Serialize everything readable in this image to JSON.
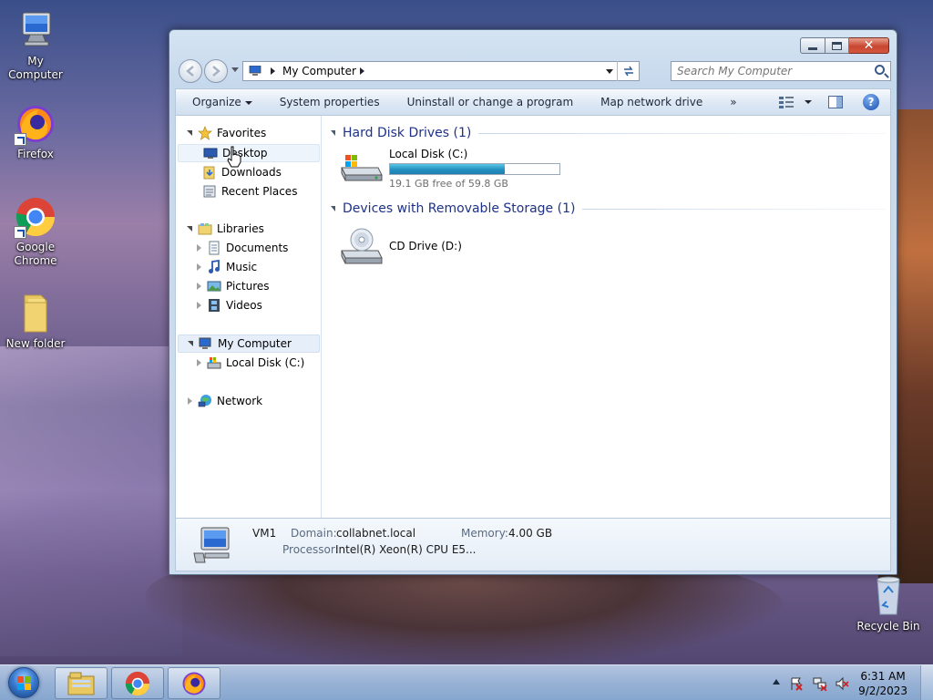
{
  "desktop": {
    "icons": [
      {
        "label": "My Computer"
      },
      {
        "label": "Firefox"
      },
      {
        "label": "Google Chrome"
      },
      {
        "label": "New folder"
      },
      {
        "label": "Recycle Bin"
      }
    ]
  },
  "window": {
    "address": {
      "crumb": "My Computer"
    },
    "search": {
      "placeholder": "Search My Computer"
    },
    "toolbar": {
      "organize": "Organize",
      "system_properties": "System properties",
      "uninstall": "Uninstall or change a program",
      "map_drive": "Map network drive",
      "more": "»"
    },
    "nav": {
      "favorites": "Favorites",
      "desktop": "Desktop",
      "downloads": "Downloads",
      "recent_places": "Recent Places",
      "libraries": "Libraries",
      "documents": "Documents",
      "music": "Music",
      "pictures": "Pictures",
      "videos": "Videos",
      "my_computer": "My Computer",
      "local_disk": "Local Disk (C:)",
      "network": "Network"
    },
    "groups": {
      "hard_disks": "Hard Disk Drives (1)",
      "removable": "Devices with Removable Storage (1)"
    },
    "drives": {
      "c": {
        "name": "Local Disk (C:)",
        "free_text": "19.1 GB free of 59.8 GB",
        "used_fraction": 0.68
      },
      "d": {
        "name": "CD Drive (D:)"
      }
    },
    "details": {
      "name": "VM1",
      "domain_label": "Domain:",
      "domain_value": "collabnet.local",
      "memory_label": "Memory:",
      "memory_value": "4.00 GB",
      "processor_label": "Processor:",
      "processor_value": "Intel(R) Xeon(R) CPU E5..."
    }
  },
  "taskbar": {
    "time": "6:31 AM",
    "date": "9/2/2023"
  },
  "colors": {
    "group_title": "#1e3287",
    "drive_fill": "#2390c0"
  }
}
